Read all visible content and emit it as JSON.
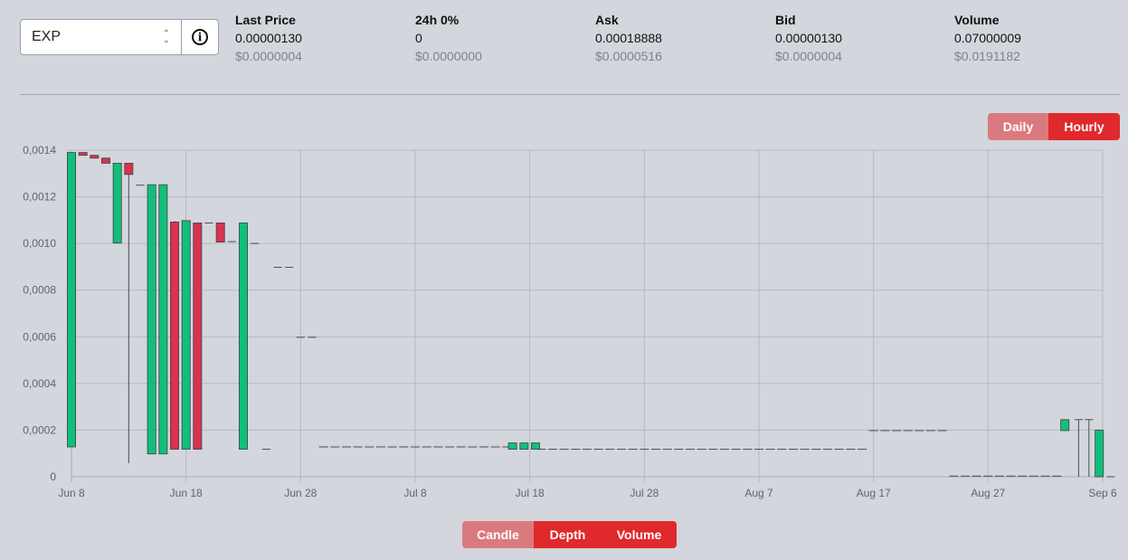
{
  "selector": {
    "value": "EXP",
    "info_icon": "info-circle-icon",
    "chevron_icon": "up-down-chevron-icon"
  },
  "stats": [
    {
      "label": "Last Price",
      "value": "0.00000130",
      "usd": "$0.0000004"
    },
    {
      "label": "24h 0%",
      "value": "0",
      "usd": "$0.0000000"
    },
    {
      "label": "Ask",
      "value": "0.00018888",
      "usd": "$0.0000516"
    },
    {
      "label": "Bid",
      "value": "0.00000130",
      "usd": "$0.0000004"
    },
    {
      "label": "Volume",
      "value": "0.07000009",
      "usd": "$0.0191182"
    }
  ],
  "interval_toggle": {
    "options": [
      "Daily",
      "Hourly"
    ],
    "active": "Hourly"
  },
  "view_toggle": {
    "options": [
      "Candle",
      "Depth",
      "Volume"
    ],
    "inactive": "Candle"
  },
  "colors": {
    "up": "#11bf7b",
    "down": "#d9334e",
    "active": "#e0292c",
    "inactive": "#db7a7e",
    "background": "#d3d6dc"
  },
  "chart_data": {
    "type": "candlestick",
    "x_ticks": [
      "Jun 8",
      "Jun 18",
      "Jun 28",
      "Jul 8",
      "Jul 18",
      "Jul 28",
      "Aug 7",
      "Aug 17",
      "Aug 27",
      "Sep 6"
    ],
    "y_ticks": [
      "0",
      "0,0002",
      "0,0004",
      "0,0006",
      "0,0008",
      "0,0010",
      "0,0012",
      "0,0014"
    ],
    "x_range": [
      "Jun 8",
      "Sep 6"
    ],
    "ylim": [
      0,
      0.0014
    ],
    "grid": true,
    "candles": [
      {
        "day": 0,
        "open": 0.000128,
        "close": 0.00139,
        "high": 0.00139,
        "low": 0.000128
      },
      {
        "day": 1,
        "open": 0.00139,
        "close": 0.001378,
        "high": 0.00139,
        "low": 0.001378
      },
      {
        "day": 2,
        "open": 0.001378,
        "close": 0.001366,
        "high": 0.001378,
        "low": 0.001366
      },
      {
        "day": 3,
        "open": 0.001366,
        "close": 0.001344,
        "high": 0.001366,
        "low": 0.001344
      },
      {
        "day": 4,
        "open": 0.001002,
        "close": 0.001344,
        "high": 0.001344,
        "low": 0.001002
      },
      {
        "day": 5,
        "open": 0.001344,
        "close": 0.001296,
        "high": 0.001344,
        "low": 5.8e-05
      },
      {
        "day": 6,
        "open": 0.00125,
        "close": 0.00125,
        "high": 0.00125,
        "low": 0.00125
      },
      {
        "day": 7,
        "open": 9.8e-05,
        "close": 0.001252,
        "high": 0.001252,
        "low": 9.8e-05
      },
      {
        "day": 8,
        "open": 9.8e-05,
        "close": 0.001252,
        "high": 0.001252,
        "low": 9.8e-05
      },
      {
        "day": 9,
        "open": 0.001092,
        "close": 0.000118,
        "high": 0.001096,
        "low": 0.000118
      },
      {
        "day": 10,
        "open": 0.000118,
        "close": 0.001098,
        "high": 0.001098,
        "low": 0.000118
      },
      {
        "day": 11,
        "open": 0.001088,
        "close": 0.000118,
        "high": 0.001088,
        "low": 0.000118
      },
      {
        "day": 12,
        "open": 0.001088,
        "close": 0.001088,
        "high": 0.001088,
        "low": 0.001088
      },
      {
        "day": 13,
        "open": 0.001088,
        "close": 0.001006,
        "high": 0.001088,
        "low": 0.001006
      },
      {
        "day": 14,
        "open": 0.001008,
        "close": 0.001008,
        "high": 0.001008,
        "low": 0.001008
      },
      {
        "day": 15,
        "open": 0.000118,
        "close": 0.001088,
        "high": 0.001088,
        "low": 0.000118
      },
      {
        "day": 16,
        "open": 0.001,
        "close": 0.001,
        "high": 0.001,
        "low": 0.001
      },
      {
        "day": 17,
        "open": 0.000118,
        "close": 0.000118,
        "high": 0.000118,
        "low": 0.000118
      },
      {
        "day": 18,
        "open": 0.000898,
        "close": 0.000898,
        "high": 0.000898,
        "low": 0.000898
      },
      {
        "day": 19,
        "open": 0.000898,
        "close": 0.000898,
        "high": 0.000898,
        "low": 0.000898
      },
      {
        "day": 20,
        "open": 0.000598,
        "close": 0.000598,
        "high": 0.000598,
        "low": 0.000598
      },
      {
        "day": 21,
        "open": 0.000598,
        "close": 0.000598,
        "high": 0.000598,
        "low": 0.000598
      },
      {
        "day": 38.5,
        "open": 0.000118,
        "close": 0.000145,
        "high": 0.000145,
        "low": 0.000118
      },
      {
        "day": 39.5,
        "open": 0.000118,
        "close": 0.000145,
        "high": 0.000145,
        "low": 0.000118
      },
      {
        "day": 40.5,
        "open": 0.000118,
        "close": 0.000145,
        "high": 0.000145,
        "low": 0.000118
      },
      {
        "day": 86.7,
        "open": 0.000198,
        "close": 0.000245,
        "high": 0.000245,
        "low": 0.000198
      },
      {
        "day": 87.9,
        "open": 0.000245,
        "close": 0.000245,
        "high": 0.000245,
        "low": 0.0
      },
      {
        "day": 88.8,
        "open": 0.000245,
        "close": 0.000245,
        "high": 0.000245,
        "low": 0.0
      },
      {
        "day": 89.7,
        "open": 0.0,
        "close": 0.0002,
        "high": 0.0002,
        "low": 0.0
      },
      {
        "day": 90.7,
        "open": 0.0,
        "close": 0.0,
        "high": 0.0,
        "low": 0.0
      }
    ],
    "flat_segments": [
      {
        "from_day": 22,
        "to_day": 38,
        "price": 0.000128
      },
      {
        "from_day": 41,
        "to_day": 69.5,
        "price": 0.000118
      },
      {
        "from_day": 70,
        "to_day": 76.5,
        "price": 0.000198
      },
      {
        "from_day": 77,
        "to_day": 86,
        "price": 3e-06
      }
    ]
  }
}
